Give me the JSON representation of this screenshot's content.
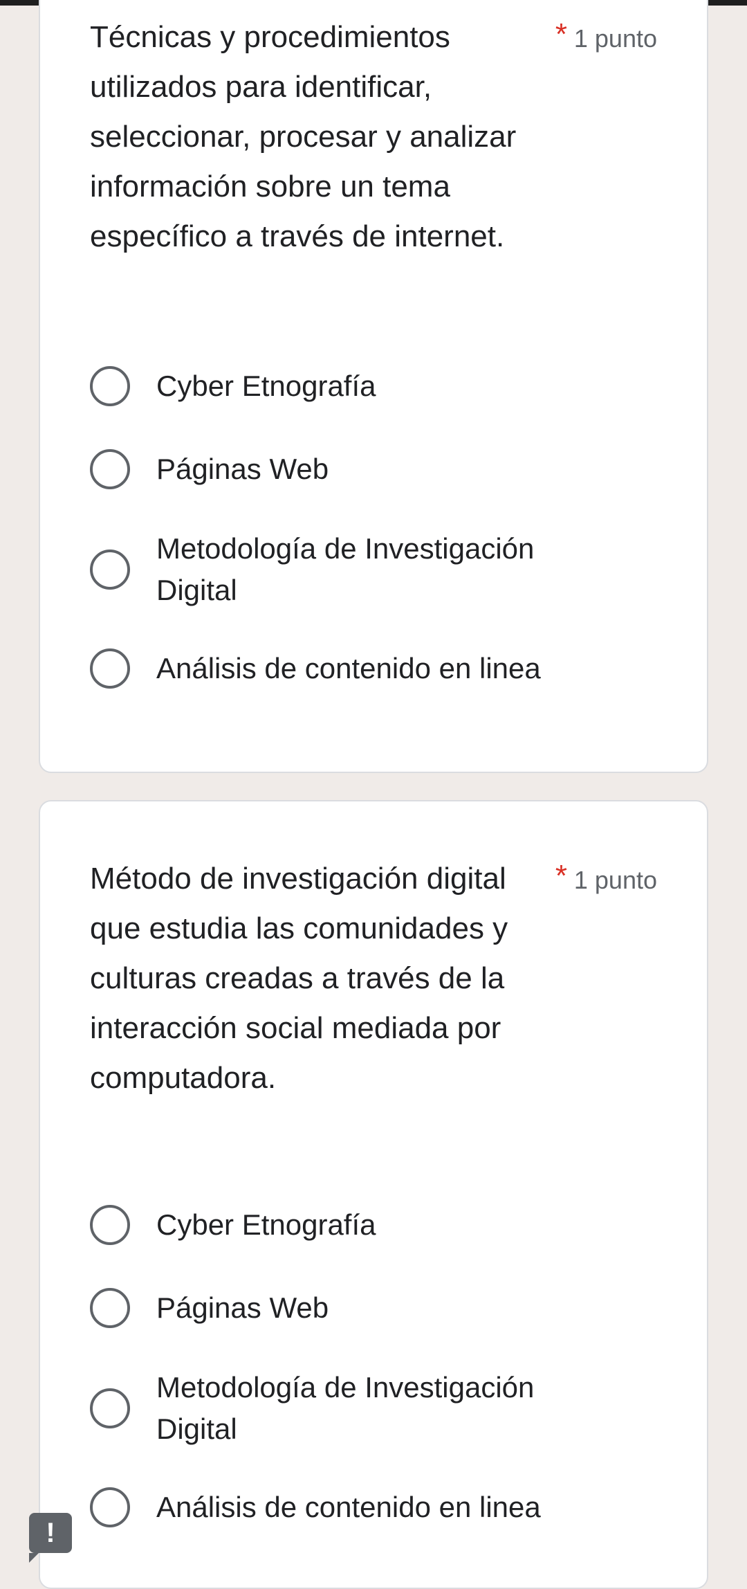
{
  "questions": [
    {
      "title": "Técnicas y procedimientos utilizados para identificar, seleccionar, procesar y analizar información sobre un tema específico a través de internet.",
      "required_mark": "*",
      "points": "1 punto",
      "options": [
        "Cyber Etnografía",
        "Páginas Web",
        "Metodología de Investigación Digital",
        "Análisis de contenido en linea"
      ]
    },
    {
      "title": "Método de investigación digital que estudia las comunidades y culturas creadas a través de la interacción social mediada por computadora.",
      "required_mark": "*",
      "points": "1 punto",
      "options": [
        "Cyber Etnografía",
        "Páginas Web",
        "Metodología de Investigación Digital",
        "Análisis de contenido en linea"
      ]
    }
  ],
  "report_button": {
    "label": "!"
  },
  "colors": {
    "required": "#d93025",
    "background": "#f0ebe8",
    "card": "#ffffff",
    "radio_border": "#5f6368"
  }
}
